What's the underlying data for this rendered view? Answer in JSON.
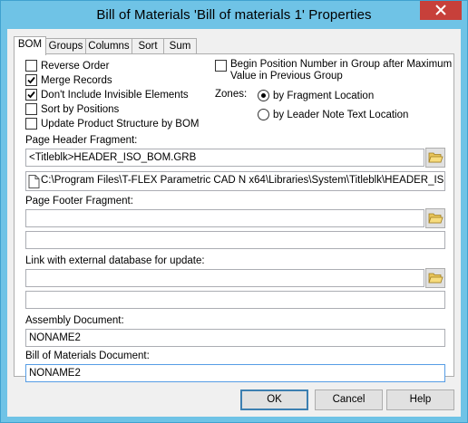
{
  "window": {
    "title": "Bill of Materials 'Bill of materials 1' Properties",
    "close_glyph": "X"
  },
  "tabs": [
    {
      "label": "BOM",
      "active": true
    },
    {
      "label": "Groups",
      "active": false
    },
    {
      "label": "Columns",
      "active": false
    },
    {
      "label": "Sort",
      "active": false
    },
    {
      "label": "Sum",
      "active": false
    }
  ],
  "options": {
    "reverse_order": {
      "label": "Reverse Order",
      "checked": false
    },
    "merge_records": {
      "label": "Merge Records",
      "checked": true
    },
    "dont_include_invisible": {
      "label": "Don't Include Invisible Elements",
      "checked": true
    },
    "sort_by_positions": {
      "label": "Sort by Positions",
      "checked": false
    },
    "update_product_structure": {
      "label": "Update Product Structure by BOM",
      "checked": false
    },
    "begin_position_number": {
      "label_line1": "Begin Position Number in Group after Maximum",
      "label_line2": "Value in Previous Group",
      "checked": false
    }
  },
  "zones": {
    "label": "Zones:",
    "by_fragment_location": {
      "label": "by Fragment Location",
      "selected": true
    },
    "by_leader_note": {
      "label": "by Leader Note Text Location",
      "selected": false
    }
  },
  "page_header": {
    "label": "Page Header Fragment:",
    "value": "<Titleblk>HEADER_ISO_BOM.GRB",
    "path": "C:\\Program Files\\T-FLEX Parametric CAD Ν  x64\\Libraries\\System\\Titleblk\\HEADER_ISO_B("
  },
  "page_footer": {
    "label": "Page Footer Fragment:",
    "value": "",
    "path": ""
  },
  "external_db": {
    "label": "Link with external database for update:",
    "value": "",
    "path": ""
  },
  "assembly_document": {
    "label": "Assembly Document:",
    "value": "NONAME2"
  },
  "bom_document": {
    "label": "Bill of Materials Document:",
    "value": "NONAME2"
  },
  "buttons": {
    "ok": "OK",
    "cancel": "Cancel",
    "help": "Help"
  },
  "colors": {
    "frame": "#6fc3e6",
    "close": "#c7403a",
    "focus_border": "#569de5"
  }
}
